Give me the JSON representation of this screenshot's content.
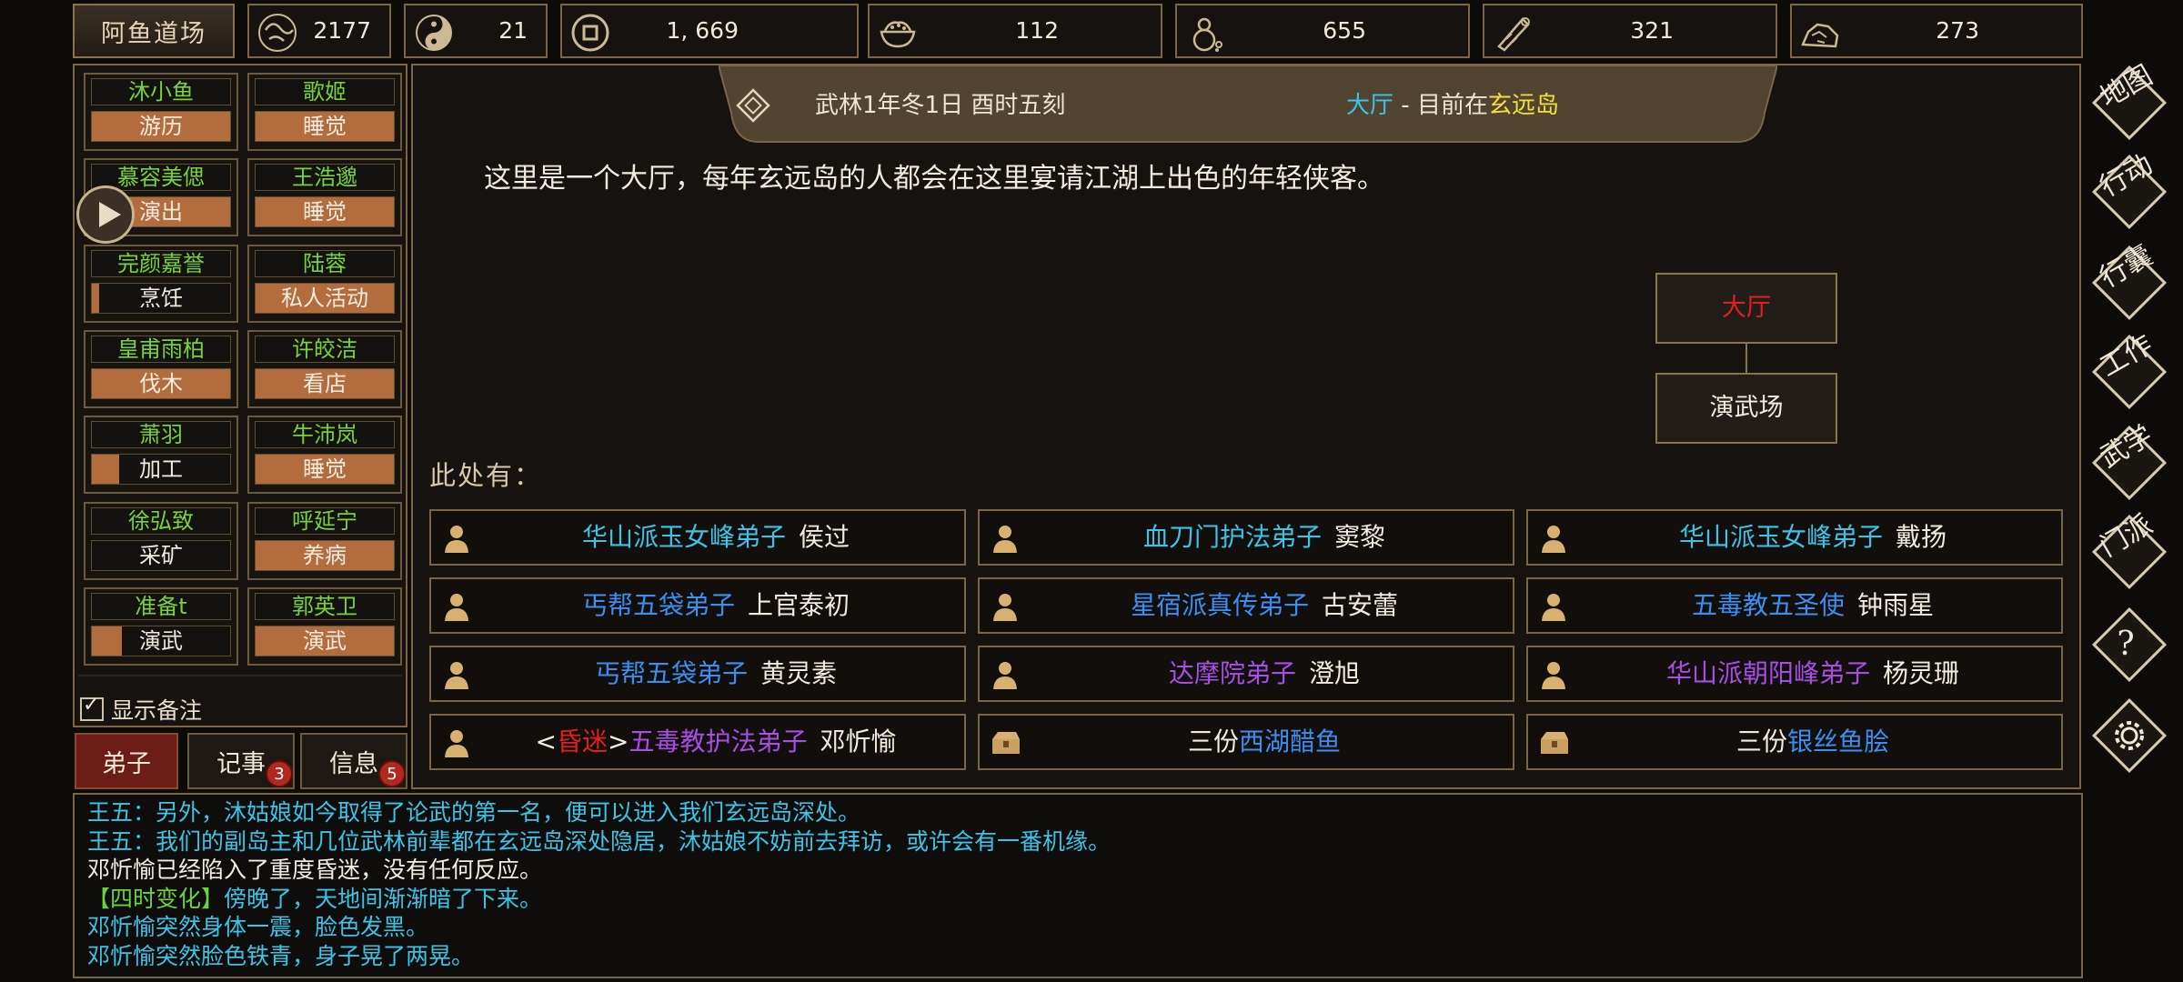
{
  "top_bar": {
    "dojo_label": "阿鱼道场",
    "resources": [
      {
        "icon": "prestige-icon",
        "value": "2177"
      },
      {
        "icon": "yin-yang-icon",
        "value": "21"
      },
      {
        "icon": "copper-coin-icon",
        "value": "1, 669"
      },
      {
        "icon": "rice-bowl-icon",
        "value": "112"
      },
      {
        "icon": "gourd-icon",
        "value": "655"
      },
      {
        "icon": "wood-log-icon",
        "value": "321"
      },
      {
        "icon": "ore-icon",
        "value": "273"
      }
    ]
  },
  "disciples": [
    {
      "name": "沐小鱼",
      "activity": "游历",
      "progress": 1.0
    },
    {
      "name": "歌姬",
      "activity": "睡觉",
      "progress": 1.0
    },
    {
      "name": "慕容美偲",
      "activity": "演出",
      "progress": 1.0
    },
    {
      "name": "王浩邈",
      "activity": "睡觉",
      "progress": 1.0
    },
    {
      "name": "完颜嘉誉",
      "activity": "烹饪",
      "progress": 0.05
    },
    {
      "name": "陆蓉",
      "activity": "私人活动",
      "progress": 1.0
    },
    {
      "name": "皇甫雨柏",
      "activity": "伐木",
      "progress": 1.0
    },
    {
      "name": "许皎洁",
      "activity": "看店",
      "progress": 1.0
    },
    {
      "name": "萧羽",
      "activity": "加工",
      "progress": 0.2
    },
    {
      "name": "牛沛岚",
      "activity": "睡觉",
      "progress": 1.0
    },
    {
      "name": "徐弘致",
      "activity": "采矿",
      "progress": 0.0
    },
    {
      "name": "呼延宁",
      "activity": "养病",
      "progress": 1.0
    },
    {
      "name": "准备t",
      "activity": "演武",
      "progress": 0.22
    },
    {
      "name": "郭英卫",
      "activity": "演武",
      "progress": 1.0
    }
  ],
  "show_notes_label": "显示备注",
  "bottom_tabs": [
    {
      "label": "弟子",
      "badge": ""
    },
    {
      "label": "记事",
      "badge": "3"
    },
    {
      "label": "信息",
      "badge": "5"
    }
  ],
  "header": {
    "date": "武林1年冬1日 酉时五刻",
    "room": "大厅",
    "sep": " - ",
    "location_prefix": "目前在",
    "location": "玄远岛"
  },
  "description": "这里是一个大厅，每年玄远岛的人都会在这里宴请江湖上出色的年轻侠客。",
  "map_rooms": {
    "current": "大厅",
    "below": "演武场"
  },
  "here_label": "此处有：",
  "entities": [
    {
      "prefix": "",
      "title": "华山派玉女峰弟子",
      "title_color": "cyan",
      "name": "侯过",
      "kind": "person"
    },
    {
      "prefix": "",
      "title": "血刀门护法弟子",
      "title_color": "cyan",
      "name": "窦黎",
      "kind": "person"
    },
    {
      "prefix": "",
      "title": "华山派玉女峰弟子",
      "title_color": "cyan",
      "name": "戴扬",
      "kind": "person"
    },
    {
      "prefix": "",
      "title": "丐帮五袋弟子",
      "title_color": "blue",
      "name": "上官泰初",
      "kind": "person"
    },
    {
      "prefix": "",
      "title": "星宿派真传弟子",
      "title_color": "blue",
      "name": "古安蕾",
      "kind": "person"
    },
    {
      "prefix": "",
      "title": "五毒教五圣使",
      "title_color": "blue",
      "name": "钟雨星",
      "kind": "person"
    },
    {
      "prefix": "",
      "title": "丐帮五袋弟子",
      "title_color": "blue",
      "name": "黄灵素",
      "kind": "person"
    },
    {
      "prefix": "",
      "title": "达摩院弟子",
      "title_color": "purple",
      "name": "澄旭",
      "kind": "person"
    },
    {
      "prefix": "",
      "title": "华山派朝阳峰弟子",
      "title_color": "purple",
      "name": "杨灵珊",
      "kind": "person"
    },
    {
      "prefix": "昏迷",
      "title": "五毒教护法弟子",
      "title_color": "purple",
      "name": "邓忻愉",
      "kind": "person"
    },
    {
      "prefix": "",
      "title": "三份",
      "title_color": "white",
      "name": "西湖醋鱼",
      "kind": "item"
    },
    {
      "prefix": "",
      "title": "三份",
      "title_color": "white",
      "name": "银丝鱼脍",
      "kind": "item"
    }
  ],
  "side_menu": [
    {
      "label": "地图",
      "icon": "map-icon"
    },
    {
      "label": "行动",
      "icon": "action-icon"
    },
    {
      "label": "行囊",
      "icon": "bag-icon"
    },
    {
      "label": "工作",
      "icon": "work-icon"
    },
    {
      "label": "武学",
      "icon": "martial-arts-icon"
    },
    {
      "label": "门派",
      "icon": "sect-icon"
    },
    {
      "label": "?",
      "icon": "help-icon"
    },
    {
      "label": "",
      "icon": "settings-gear-icon"
    }
  ],
  "log": [
    {
      "text": "王五：另外，沐姑娘如今取得了论武的第一名，便可以进入我们玄远岛深处。",
      "color": "#3cc4e8"
    },
    {
      "text": "王五：我们的副岛主和几位武林前辈都在玄远岛深处隐居，沐姑娘不妨前去拜访，或许会有一番机缘。",
      "color": "#3cc4e8"
    },
    {
      "text": "邓忻愉已经陷入了重度昏迷，没有任何反应。",
      "color": "#f2ece0"
    },
    {
      "text": "【四时变化】傍晚了，天地间渐渐暗了下来。",
      "color": "#3cc4e8",
      "lead": "【四时变化】",
      "lead_color": "#6ad23a"
    },
    {
      "text": "邓忻愉突然身体一震，脸色发黑。",
      "color": "#3cc4e8"
    },
    {
      "text": "邓忻愉突然脸色铁青，身子晃了两晃。",
      "color": "#3cc4e8"
    }
  ],
  "colors": {
    "gold_border": "#7a6646",
    "progress_fill": "#b26c3e",
    "name_green": "#79d23a",
    "cyan": "#3cc4e8",
    "blue": "#3b8ff2",
    "purple": "#a74ee6",
    "red": "#e02020",
    "yellow": "#f2e03c"
  }
}
